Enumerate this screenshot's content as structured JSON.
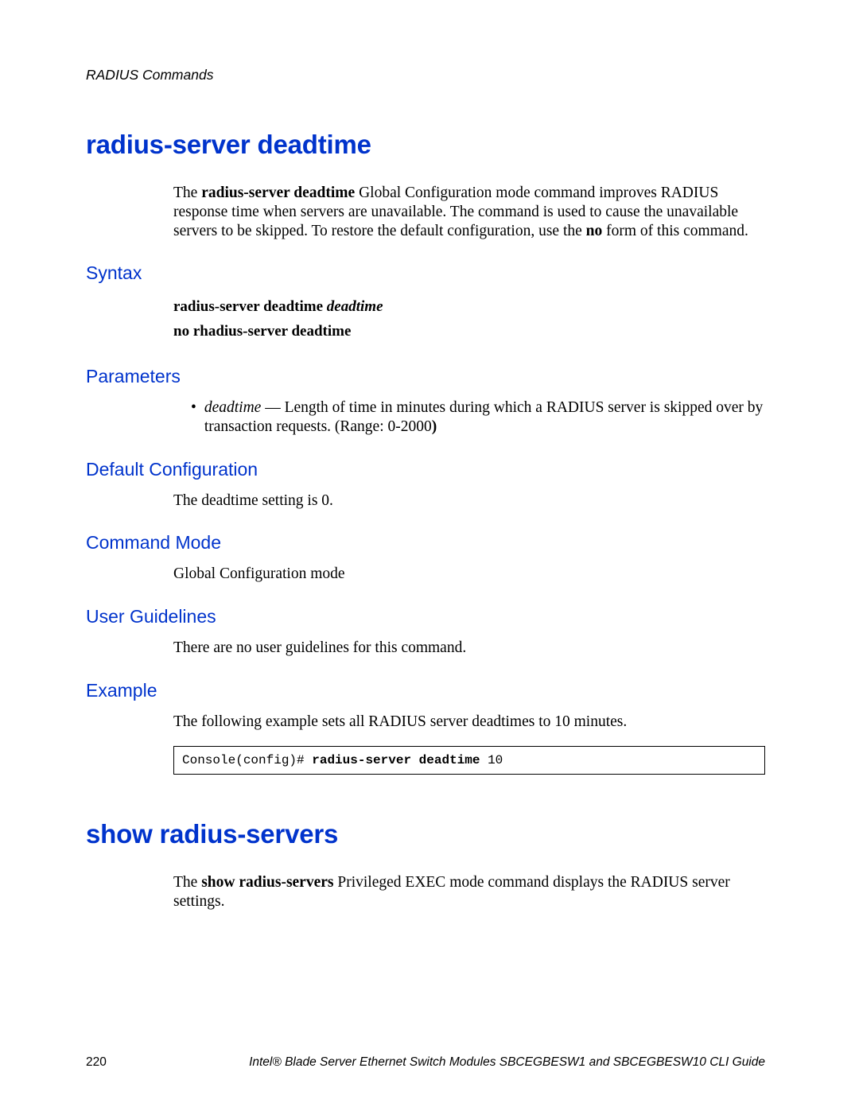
{
  "header": {
    "chapter": "RADIUS Commands"
  },
  "section1": {
    "title": "radius-server deadtime",
    "intro": {
      "pre": "The ",
      "cmd": "radius-server deadtime",
      "mid": " Global Configuration mode command improves RADIUS response time when servers are unavailable. The command is used to cause the unavailable servers to be skipped. To restore the default configuration, use the ",
      "no": "no",
      "post": " form of this command."
    },
    "syntax": {
      "heading": "Syntax",
      "line1_cmd": "radius-server deadtime",
      "line1_arg": "deadtime",
      "line2": "no rhadius-server deadtime"
    },
    "parameters": {
      "heading": "Parameters",
      "item": {
        "name": "deadtime",
        "desc_pre": " — Length of time in minutes during which a RADIUS server is skipped over by transaction requests. (Range: 0-2000",
        "desc_post": ")"
      }
    },
    "default_config": {
      "heading": "Default Configuration",
      "text": "The deadtime setting is 0."
    },
    "command_mode": {
      "heading": "Command Mode",
      "text": "Global Configuration mode"
    },
    "user_guidelines": {
      "heading": "User Guidelines",
      "text": "There are no user guidelines for this command."
    },
    "example": {
      "heading": "Example",
      "text": "The following example sets all RADIUS server deadtimes to 10 minutes.",
      "code_prompt": "Console(config)# ",
      "code_cmd": "radius-server deadtime",
      "code_arg": " 10"
    }
  },
  "section2": {
    "title": "show radius-servers",
    "intro": {
      "pre": "The ",
      "cmd": "show radius-servers",
      "post": " Privileged EXEC mode command displays the RADIUS server settings."
    }
  },
  "footer": {
    "page": "220",
    "book": "Intel® Blade Server Ethernet Switch Modules SBCEGBESW1 and SBCEGBESW10 CLI Guide"
  }
}
